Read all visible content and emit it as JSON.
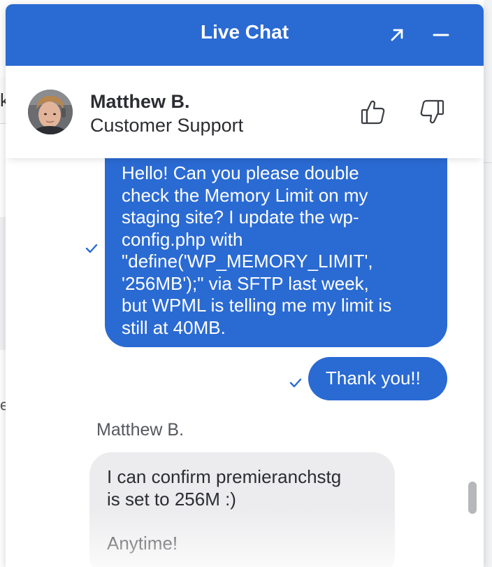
{
  "header": {
    "title": "Live Chat",
    "expand_icon": "arrow-up-right-icon",
    "minimize_icon": "minus-icon"
  },
  "agent": {
    "name": "Matthew B.",
    "role": "Customer Support",
    "avatar_icon": "agent-avatar",
    "thumbs_up_icon": "thumbs-up-icon",
    "thumbs_down_icon": "thumbs-down-icon"
  },
  "messages": {
    "outgoing": [
      {
        "text": "Hello! Can you please double\ncheck the Memory Limit on my\nstaging site? I update the wp-\nconfig.php with\n\"define('WP_MEMORY_LIMIT',\n'256MB');\" via SFTP last week,\nbut WPML is telling me my limit is\nstill at 40MB.",
        "status_icon": "check-icon"
      },
      {
        "text": "Thank you!!",
        "status_icon": "check-icon"
      }
    ],
    "incoming": {
      "sender": "Matthew B.",
      "text": "I can confirm premieranchstg\nis set to 256M :)",
      "text2": "Anytime!"
    }
  },
  "colors": {
    "brand_blue": "#2a6ad3",
    "incoming_bubble": "#ececee",
    "text_dark": "#2b2d31"
  }
}
